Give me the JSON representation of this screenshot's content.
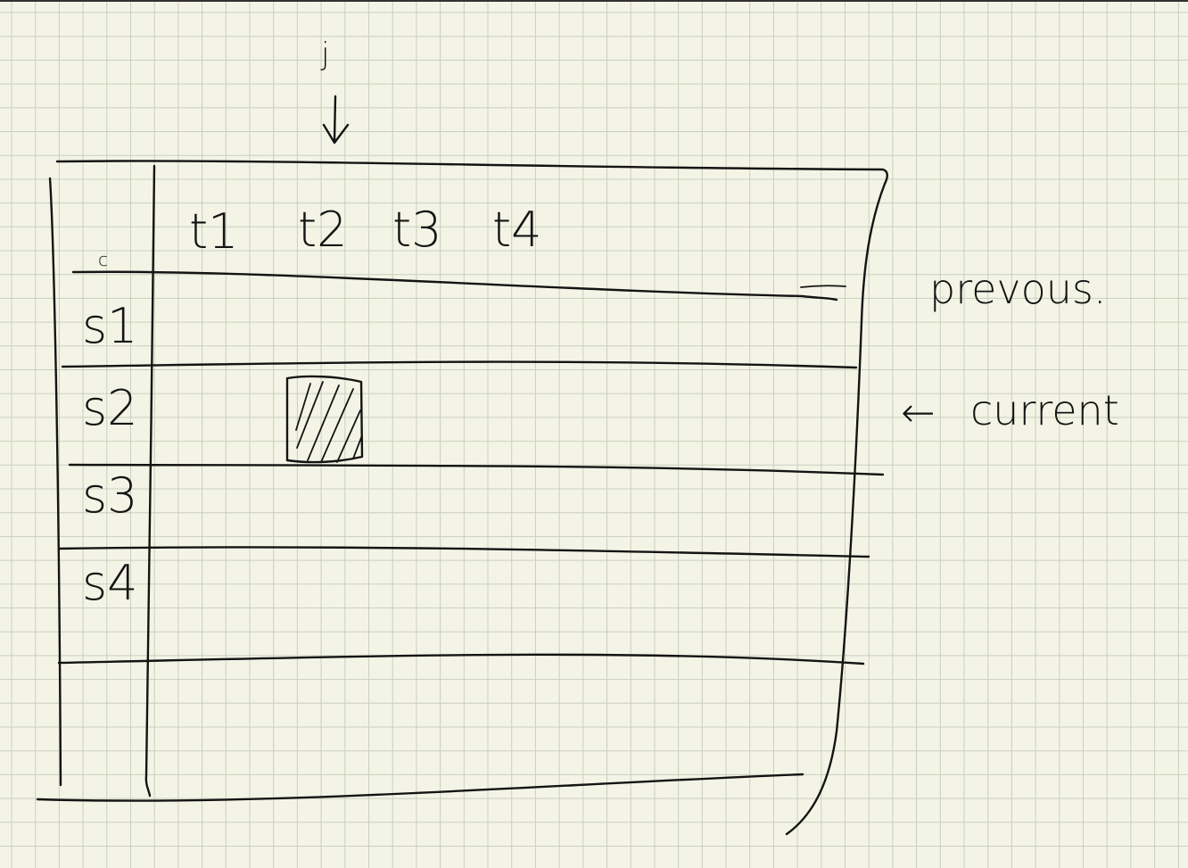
{
  "colors": {
    "paper": "#f4f4e6",
    "grid": "#c9cfbd",
    "ink": "#141414"
  },
  "annotations": {
    "pointer_label": "j",
    "previous_label": "prevous.",
    "current_label": "current",
    "current_arrow": "←",
    "down_arrow": "↓"
  },
  "table": {
    "corner_mark": "c",
    "columns": [
      "t1",
      "t2",
      "t3",
      "t4"
    ],
    "rows": [
      "s1",
      "s2",
      "s3",
      "s4",
      ""
    ],
    "highlighted_cell": {
      "row": "s2",
      "column": "t2"
    }
  }
}
